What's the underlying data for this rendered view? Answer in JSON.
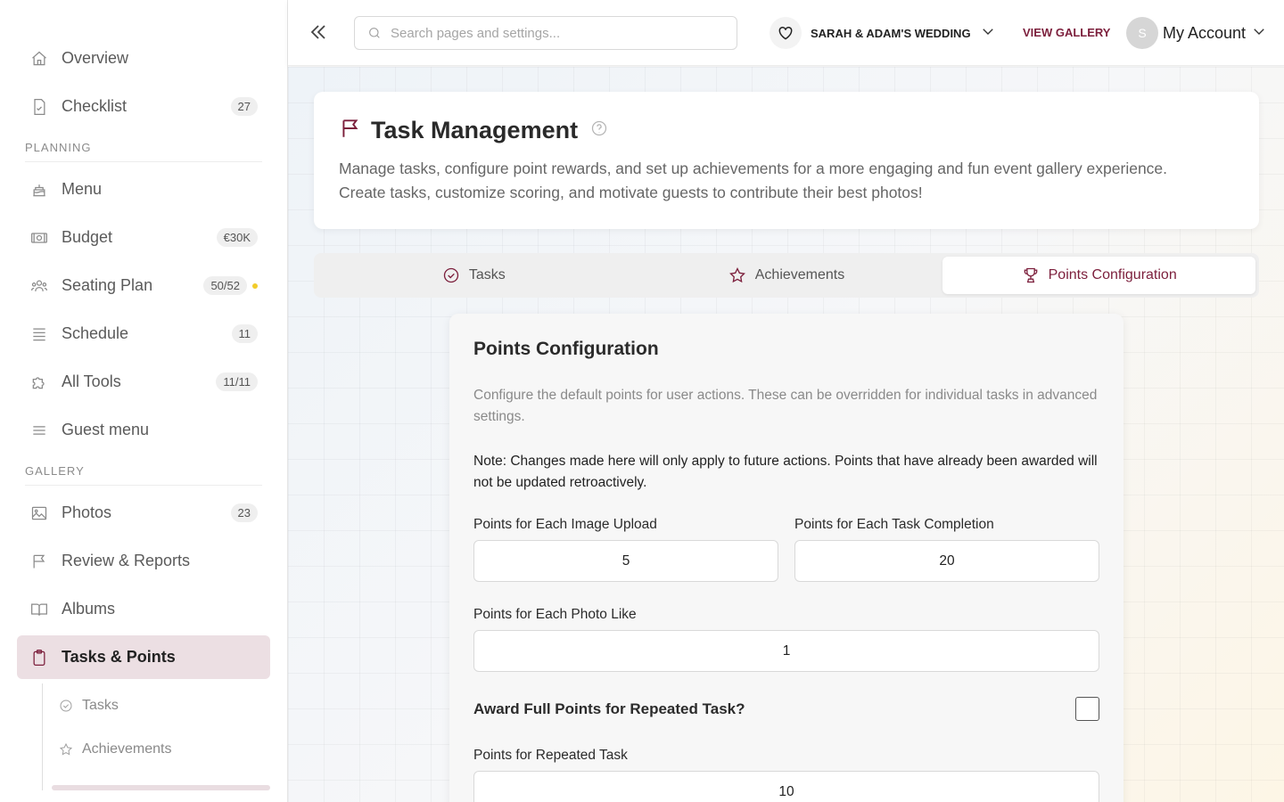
{
  "sidebar": {
    "top_items": [
      {
        "label": "Overview",
        "badge": ""
      },
      {
        "label": "Checklist",
        "badge": "27"
      }
    ],
    "planning_label": "PLANNING",
    "planning_items": [
      {
        "label": "Menu",
        "badge": ""
      },
      {
        "label": "Budget",
        "badge": "€30K"
      },
      {
        "label": "Seating Plan",
        "badge": "50/52"
      },
      {
        "label": "Schedule",
        "badge": "11"
      },
      {
        "label": "All Tools",
        "badge": "11/11"
      },
      {
        "label": "Guest menu",
        "badge": ""
      }
    ],
    "gallery_label": "GALLERY",
    "gallery_items": [
      {
        "label": "Photos",
        "badge": "23"
      },
      {
        "label": "Review & Reports",
        "badge": ""
      },
      {
        "label": "Albums",
        "badge": ""
      },
      {
        "label": "Tasks & Points",
        "badge": ""
      }
    ],
    "sub_items": [
      {
        "label": "Tasks"
      },
      {
        "label": "Achievements"
      }
    ]
  },
  "topbar": {
    "search_placeholder": "Search pages and settings...",
    "event_name": "SARAH & ADAM'S WEDDING",
    "view_gallery": "VIEW GALLERY",
    "avatar_initial": "S",
    "account_label": "My Account"
  },
  "header": {
    "title": "Task Management",
    "description_line1": "Manage tasks, configure point rewards, and set up achievements for a more engaging and fun event gallery experience.",
    "description_line2": "Create tasks, customize scoring, and motivate guests to contribute their best photos!"
  },
  "tabs": [
    {
      "label": "Tasks"
    },
    {
      "label": "Achievements"
    },
    {
      "label": "Points Configuration"
    }
  ],
  "config": {
    "title": "Points Configuration",
    "description": "Configure the default points for user actions. These can be overridden for individual tasks in advanced settings.",
    "note": "Note: Changes made here will only apply to future actions. Points that have already been awarded will not be updated retroactively.",
    "image_upload_label": "Points for Each Image Upload",
    "image_upload_value": "5",
    "task_completion_label": "Points for Each Task Completion",
    "task_completion_value": "20",
    "photo_like_label": "Points for Each Photo Like",
    "photo_like_value": "1",
    "repeated_task_question": "Award Full Points for Repeated Task?",
    "repeated_task_checked": false,
    "repeated_task_label": "Points for Repeated Task",
    "repeated_task_value": "10"
  },
  "colors": {
    "accent": "#7c1f3c",
    "active_bg": "#ecdfe3",
    "status_dot": "#f2cc2a"
  }
}
